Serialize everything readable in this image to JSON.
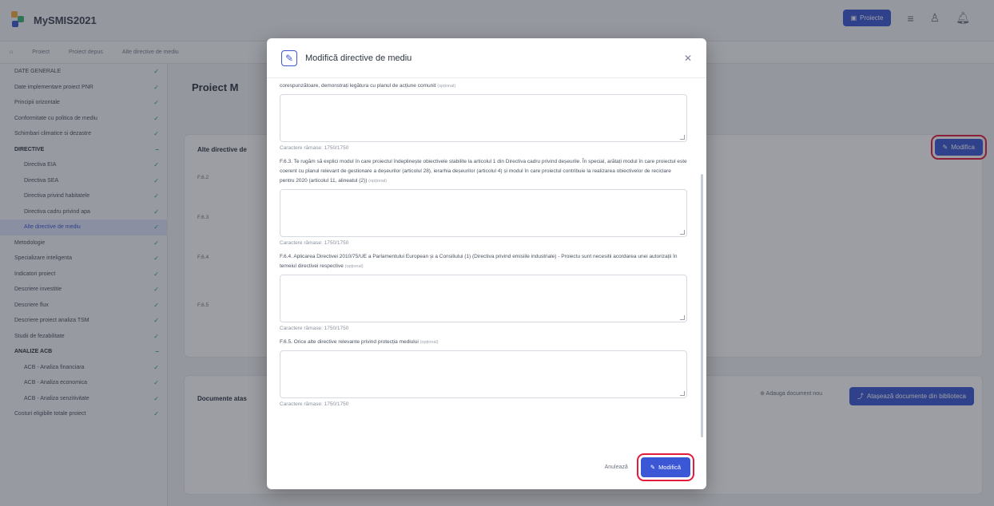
{
  "app": {
    "title": "MySMIS2021",
    "project_button": "Proiecte"
  },
  "breadcrumb": [
    "Proiect",
    "Proiect depus",
    "Alte directive de mediu"
  ],
  "sidebar": {
    "items": [
      {
        "label": "DATE GENERALE",
        "type": "item"
      },
      {
        "label": "Date implementare proiect PNR",
        "type": "item"
      },
      {
        "label": "Principii orizontale",
        "type": "item"
      },
      {
        "label": "Conformitate cu politica de mediu",
        "type": "item"
      },
      {
        "label": "Schimbari climatice si dezastre",
        "type": "item"
      },
      {
        "label": "DIRECTIVE",
        "type": "section"
      },
      {
        "label": "Directiva EIA",
        "type": "sub"
      },
      {
        "label": "Directiva SEA",
        "type": "sub"
      },
      {
        "label": "Directiva privind habitatele",
        "type": "sub"
      },
      {
        "label": "Directiva cadru privind apa",
        "type": "sub"
      },
      {
        "label": "Alte directive de mediu",
        "type": "sub-active"
      },
      {
        "label": "Metodologie",
        "type": "item"
      },
      {
        "label": "Specializare inteligenta",
        "type": "item"
      },
      {
        "label": "Indicatori proiect",
        "type": "item"
      },
      {
        "label": "Descriere investitie",
        "type": "item"
      },
      {
        "label": "Descriere flux",
        "type": "item"
      },
      {
        "label": "Descriere proiect analiza TSM",
        "type": "item"
      },
      {
        "label": "Studii de fezabilitate",
        "type": "item"
      },
      {
        "label": "ANALIZE ACB",
        "type": "section"
      },
      {
        "label": "ACB - Analiza financiara",
        "type": "sub"
      },
      {
        "label": "ACB - Analiza economica",
        "type": "sub"
      },
      {
        "label": "ACB - Analiza senzitivitate",
        "type": "sub"
      },
      {
        "label": "Costuri eligibile totale proiect",
        "type": "item"
      }
    ]
  },
  "main": {
    "project_title": "Proiect M",
    "card_title": "Alte directive de",
    "modify_label": "Modifica",
    "documents_title": "Documente atas",
    "add_document": "Adauga document nou",
    "attach_documents": "Atașează documente din biblioteca"
  },
  "modal": {
    "title": "Modifică directive de mediu",
    "intro_text": "corespunzătoare, demonstrați legătura cu planul de acțiune comunit",
    "optional": "(opțional)",
    "fields": [
      {
        "label": "",
        "remaining": "Caractere rămase: 1750/1750"
      },
      {
        "label": "F.6.3. Te rugăm să explici modul în care proiectul îndeplinește obiectivele stabilite la articolul 1 din Directiva cadru privind deșeurile. În special, arătați modul în care proiectul este coerent cu planul relevant de gestionare a deșeurilor (articolul 28), ierarhia deșeurilor (articolul 4) și modul în care proiectul contribuie la realizarea obiectivelor de reciclare pentru 2020 (articolul 11, alineatul (2))",
        "remaining": "Caractere rămase: 1750/1750"
      },
      {
        "label": "F.6.4. Aplicarea Directivei 2010/75/UE a Parlamentului European și a Consiliului (1) (Directiva privind emisiile industriale) - Proiectu sunt necesitii acordarea unei autorizații în temeiul directivei respective",
        "remaining": "Caractere rămase: 1750/1750"
      },
      {
        "label": "F.6.5. Orice alte directive relevante privind protecția mediului",
        "remaining": "Caractere rămase: 1750/1750"
      }
    ],
    "cancel_label": "Anulează",
    "submit_label": "Modifică"
  },
  "colors": {
    "accent": "#3b57d6",
    "highlight": "#e21b3c",
    "success": "#2f9e6a"
  }
}
